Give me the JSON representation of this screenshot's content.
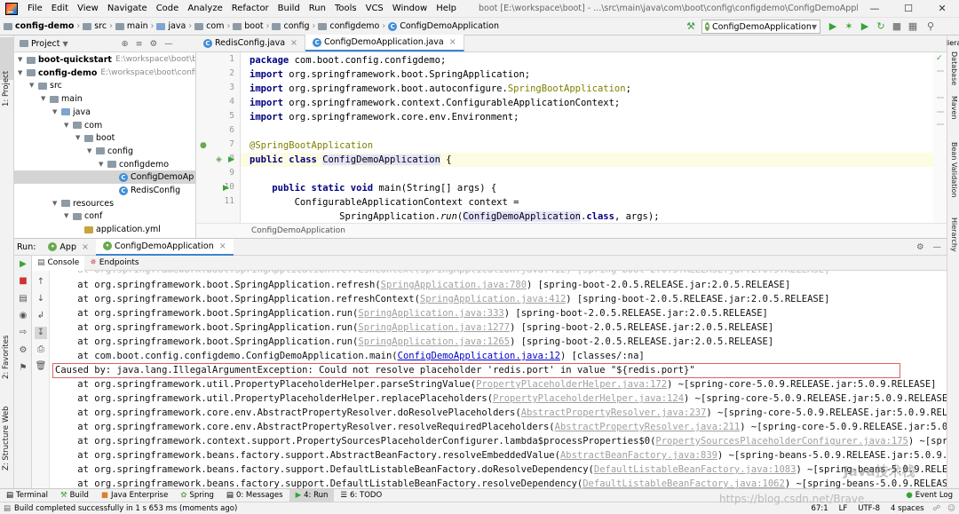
{
  "menubar": {
    "items": [
      "File",
      "Edit",
      "View",
      "Navigate",
      "Code",
      "Analyze",
      "Refactor",
      "Build",
      "Run",
      "Tools",
      "VCS",
      "Window",
      "Help"
    ],
    "title": "boot [E:\\workspace\\boot] - ...\\src\\main\\java\\com\\boot\\config\\configdemo\\ConfigDemoApplication.java [config-demo]"
  },
  "navbar": {
    "crumbs": [
      "config-demo",
      "src",
      "main",
      "java",
      "com",
      "boot",
      "config",
      "configdemo",
      "ConfigDemoApplication"
    ],
    "run_config": "ConfigDemoApplication"
  },
  "left_strip": {
    "project": "1: Project",
    "favorites": "2: Favorites",
    "web": "Web",
    "structure": "Z: Structure"
  },
  "right_strip": {
    "hierarchy_top": "Hiera",
    "database": "Database",
    "maven": "Maven",
    "bean": "Bean Validation",
    "hierarchy": "Hierarchy"
  },
  "project": {
    "header": "Project",
    "tree": [
      {
        "label": "boot-quickstart",
        "path": "E:\\workspace\\boot\\boot-...",
        "indent": 0,
        "kind": "module",
        "bold": true
      },
      {
        "label": "config-demo",
        "path": "E:\\workspace\\boot\\config-d...",
        "indent": 0,
        "kind": "module",
        "bold": true
      },
      {
        "label": "src",
        "path": "",
        "indent": 1,
        "kind": "folder"
      },
      {
        "label": "main",
        "path": "",
        "indent": 2,
        "kind": "folder"
      },
      {
        "label": "java",
        "path": "",
        "indent": 3,
        "kind": "folder-blue"
      },
      {
        "label": "com",
        "path": "",
        "indent": 4,
        "kind": "folder"
      },
      {
        "label": "boot",
        "path": "",
        "indent": 5,
        "kind": "folder"
      },
      {
        "label": "config",
        "path": "",
        "indent": 6,
        "kind": "folder"
      },
      {
        "label": "configdemo",
        "path": "",
        "indent": 7,
        "kind": "folder"
      },
      {
        "label": "ConfigDemoAp",
        "path": "",
        "indent": 8,
        "kind": "class",
        "selected": true
      },
      {
        "label": "RedisConfig",
        "path": "",
        "indent": 8,
        "kind": "class"
      },
      {
        "label": "resources",
        "path": "",
        "indent": 3,
        "kind": "folder"
      },
      {
        "label": "conf",
        "path": "",
        "indent": 4,
        "kind": "folder"
      },
      {
        "label": "application.yml",
        "path": "",
        "indent": 5,
        "kind": "file"
      }
    ]
  },
  "editor": {
    "tabs": [
      "RedisConfig.java",
      "ConfigDemoApplication.java"
    ],
    "line_numbers": [
      "1",
      "2",
      "3",
      "4",
      "5",
      "6",
      "7",
      "8",
      "9",
      "10",
      "11"
    ],
    "breadcrumb": "ConfigDemoApplication"
  },
  "run": {
    "label": "Run:",
    "tabs": [
      "App",
      "ConfigDemoApplication"
    ],
    "console_tabs": [
      "Console",
      "Endpoints"
    ],
    "caused_by": "Caused by: java.lang.IllegalArgumentException: Could not resolve placeholder 'redis.port' in value \"${redis.port}\""
  },
  "bottom_tabs": [
    "Terminal",
    "Build",
    "Java Enterprise",
    "Spring",
    "0: Messages",
    "4: Run",
    "6: TODO"
  ],
  "event_log": "Event Log",
  "status": {
    "message": "Build completed successfully in 1 s 653 ms (moments ago)",
    "position": "67:1",
    "line_sep": "LF",
    "encoding": "UTF-8",
    "indent": "4 spaces"
  },
  "watermark": "Java技术栈",
  "watermark_url": "https://blog.csdn.net/Brave..."
}
